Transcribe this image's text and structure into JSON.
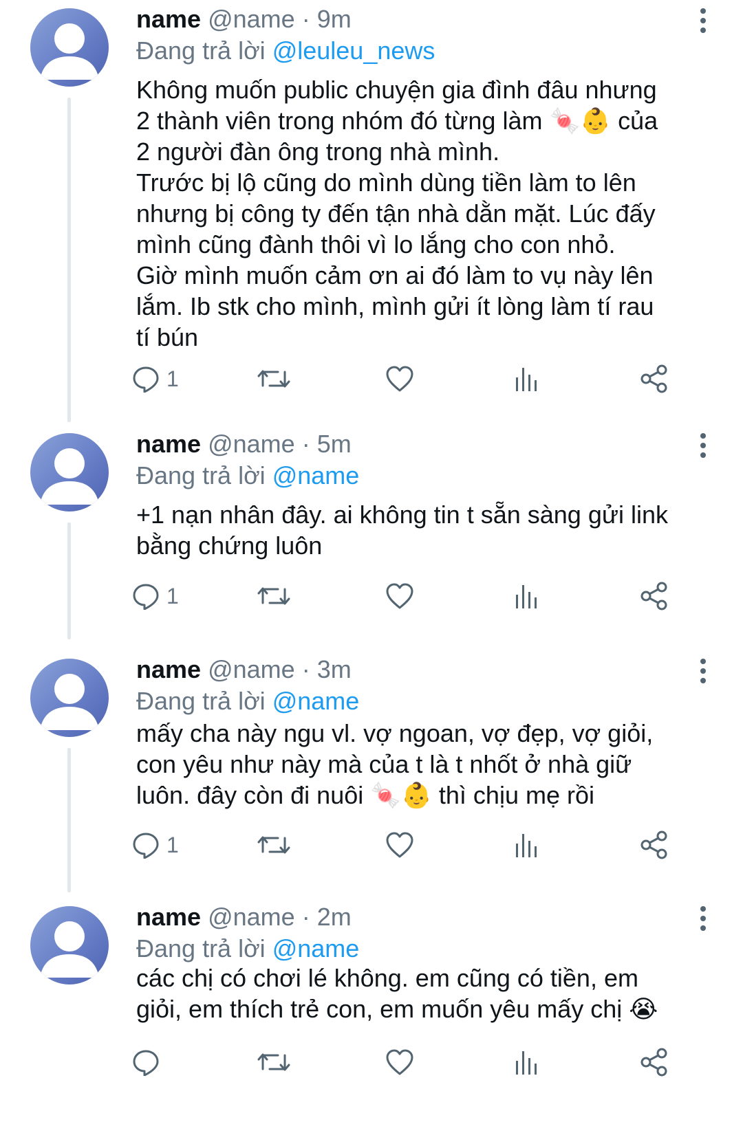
{
  "tweets": [
    {
      "name": "name",
      "handle": "@name",
      "sep": "·",
      "time": "9m",
      "reply_prefix": "Đang trả lời",
      "reply_to": "@leuleu_news",
      "text": "Không muốn public chuyện gia đình đâu nhưng\n2 thành viên trong nhóm đó từng làm 🍬👶 của\n2 người đàn ông trong nhà mình.\nTrước bị lộ cũng do mình dùng tiền làm to lên\nnhưng bị công ty đến tận nhà dằn mặt. Lúc đấy\nmình cũng đành thôi vì lo lắng cho con nhỏ.\nGiờ mình muốn cảm ơn ai đó làm to vụ này lên\nlắm. Ib stk cho mình, mình gửi ít lòng làm tí rau\ntí bún",
      "reply_count": "1"
    },
    {
      "name": "name",
      "handle": "@name",
      "sep": "·",
      "time": "5m",
      "reply_prefix": "Đang trả lời",
      "reply_to": "@name",
      "text": "+1 nạn nhân đây. ai không tin t sẵn sàng gửi link\nbằng chứng luôn",
      "reply_count": "1"
    },
    {
      "name": "name",
      "handle": "@name",
      "sep": "·",
      "time": "3m",
      "reply_prefix": "Đang trả lời",
      "reply_to": "@name",
      "text": "mấy cha này ngu vl. vợ ngoan, vợ đẹp, vợ giỏi,\ncon yêu như này mà của t là t nhốt ở nhà giữ\nluôn. đây còn đi nuôi 🍬👶 thì chịu mẹ rồi",
      "reply_count": "1"
    },
    {
      "name": "name",
      "handle": "@name",
      "sep": "·",
      "time": "2m",
      "reply_prefix": "Đang trả lời",
      "reply_to": "@name",
      "text": "các chị có chơi lé không. em cũng có tiền, em\ngiỏi, em thích trẻ con, em muốn yêu mấy chị 😭",
      "reply_count": ""
    }
  ],
  "icons": {
    "reply": "speech-bubble-icon",
    "retweet": "retweet-icon",
    "like": "heart-icon",
    "analytics": "bar-chart-icon",
    "share": "share-icon",
    "more": "vertical-dots-icon",
    "avatar": "default-profile-avatar"
  },
  "colors": {
    "link": "#1d9bf0",
    "secondary_text": "#687684",
    "icon": "#536471",
    "thread_line": "#e1e8ed",
    "avatar": "#6b82c9"
  }
}
